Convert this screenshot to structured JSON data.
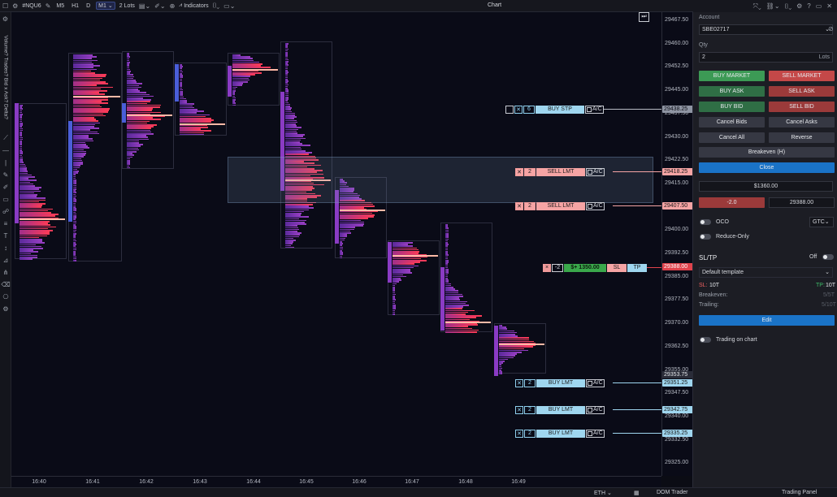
{
  "topbar": {
    "symbol": "#NQU6",
    "timeframes": [
      "M5",
      "H1",
      "D",
      "M1"
    ],
    "active_timeframe": "M1",
    "lots": "2",
    "lots_unit": "Lots",
    "indicators_label": "Indicators",
    "chart_title": "Chart"
  },
  "left_tools": {
    "indicator_list": "Volume? Trades? Bid x Ask? Delta?"
  },
  "price_axis": {
    "labels": [
      "29467.50",
      "29460.00",
      "29452.50",
      "29445.00",
      "29437.50",
      "29430.00",
      "29422.50",
      "29415.00",
      "29407.50",
      "29400.00",
      "29392.50",
      "29385.00",
      "29377.50",
      "29370.00",
      "29362.50",
      "29355.00",
      "29347.50",
      "29340.00",
      "29332.50",
      "29325.00"
    ],
    "badges": [
      {
        "text": "29438.25",
        "bg": "#8f95a3",
        "fg": "#0b0c14"
      },
      {
        "text": "29418.25",
        "bg": "#f6a4a4",
        "fg": "#1a1a1a"
      },
      {
        "text": "29407.50",
        "bg": "#f6a4a4",
        "fg": "#1a1a1a"
      },
      {
        "text": "29388.00",
        "bg": "#e0434c",
        "fg": "#ffffff"
      },
      {
        "text": "29353.75",
        "bg": "#2a2c38",
        "fg": "#e6e8ec"
      },
      {
        "text": "29351.25",
        "bg": "#9fd6ef",
        "fg": "#1a1a1a"
      },
      {
        "text": "29342.75",
        "bg": "#9fd6ef",
        "fg": "#1a1a1a"
      },
      {
        "text": "29335.25",
        "bg": "#9fd6ef",
        "fg": "#1a1a1a"
      }
    ]
  },
  "time_axis": {
    "labels": [
      "16:40",
      "16:41",
      "16:42",
      "16:43",
      "16:44",
      "16:45",
      "16:46",
      "16:47",
      "16:48",
      "16:49"
    ]
  },
  "orders": [
    {
      "side": "buy",
      "qty": "6",
      "label": "BUY STP",
      "ac": "A/C",
      "color": "#b8bbc4"
    },
    {
      "side": "sell",
      "qty": "2",
      "label": "SELL LMT",
      "ac": "A/C",
      "color": "#f6a4a4"
    },
    {
      "side": "sell",
      "qty": "2",
      "label": "SELL LMT",
      "ac": "A/C",
      "color": "#f6a4a4"
    },
    {
      "side": "buy",
      "qty": "2",
      "label": "BUY LMT",
      "ac": "A/C",
      "color": "#9fd6ef"
    },
    {
      "side": "buy",
      "qty": "2",
      "label": "BUY LMT",
      "ac": "A/C",
      "color": "#9fd6ef"
    },
    {
      "side": "buy",
      "qty": "2",
      "label": "BUY LMT",
      "ac": "A/C",
      "color": "#9fd6ef"
    }
  ],
  "position": {
    "close": "×",
    "qty": "-2",
    "pnl": "$+ 1350.00",
    "sl": "SL",
    "tp": "TP"
  },
  "panel": {
    "account_label": "Account",
    "account": "SBE02717",
    "qty_label": "Qty",
    "qty": "2",
    "qty_unit": "Lots",
    "buy_market": "BUY MARKET",
    "sell_market": "SELL MARKET",
    "buy_ask": "BUY ASK",
    "sell_ask": "SELL ASK",
    "buy_bid": "BUY BID",
    "sell_bid": "SELL BID",
    "cancel_bids": "Cancel Bids",
    "cancel_asks": "Cancel Asks",
    "cancel_all": "Cancel All",
    "reverse": "Reverse",
    "breakeven": "Breakeven (H)",
    "close": "Close",
    "pnl": "$1360.00",
    "position_qty": "-2.0",
    "avg_price": "29388.00",
    "oco": "OCO",
    "tif": "GTC",
    "reduce_only": "Reduce-Only",
    "sltp_title": "SL/TP",
    "sltp_state": "Off",
    "template": "Default template",
    "sl_label": "SL:",
    "sl_value": "10T",
    "tp_label": "TP:",
    "tp_value": "10T",
    "breakeven_label": "Breakeven:",
    "breakeven_value": "5/5T",
    "trailing_label": "Trailing:",
    "trailing_value": "5/10T",
    "edit": "Edit",
    "trading_on_chart": "Trading on chart"
  },
  "bottombar": {
    "session": "ETH",
    "dom_trader": "DOM Trader",
    "trading_panel": "Trading Panel"
  },
  "colors": {
    "chart_bg": "#0a0b17",
    "panel_bg": "#1c1d24",
    "buy_green": "#3c9a55",
    "sell_red": "#c44848",
    "close_blue": "#1a73c7",
    "profile_purple": "#8a3bc4",
    "profile_pink": "#e0336a",
    "value_area_blue": "#4a5ed8"
  },
  "icons": [
    "search-icon",
    "settings-icon",
    "crosshair-icon",
    "pencil-icon",
    "line-icon",
    "text-icon",
    "ruler-icon",
    "magnet-icon",
    "close-icon",
    "camera-icon",
    "link-icon",
    "help-icon",
    "window-icon"
  ]
}
